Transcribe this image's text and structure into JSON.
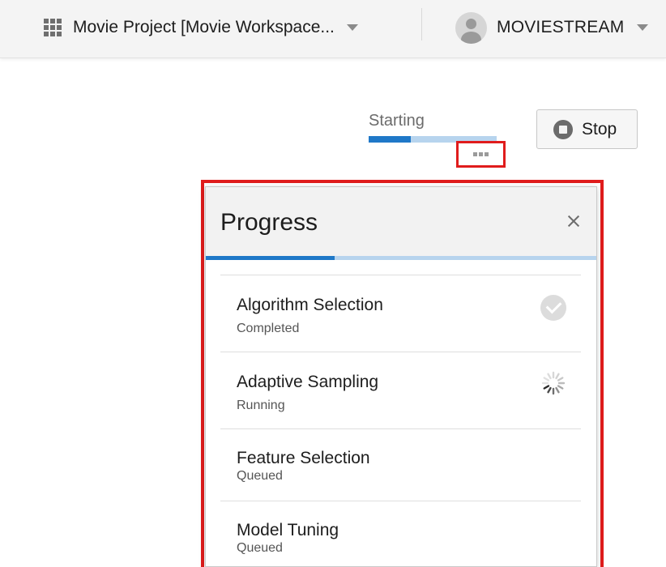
{
  "header": {
    "project_label": "Movie Project [Movie Workspace...",
    "user_name": "MOVIESTREAM"
  },
  "run": {
    "status_text": "Starting",
    "progress": 0.33,
    "stop_label": "Stop"
  },
  "popup": {
    "title": "Progress",
    "progress": 0.33,
    "steps": [
      {
        "name": "Algorithm Selection",
        "status": "Completed",
        "icon": "check-circle-icon"
      },
      {
        "name": "Adaptive Sampling",
        "status": "Running",
        "icon": "spinner-icon"
      },
      {
        "name": "Feature Selection",
        "status": "Queued",
        "icon": ""
      },
      {
        "name": "Model Tuning",
        "status": "Queued",
        "icon": ""
      }
    ]
  },
  "colors": {
    "accent": "#1f78c8",
    "track": "#b7d4ee",
    "highlight": "#e01c1c"
  }
}
